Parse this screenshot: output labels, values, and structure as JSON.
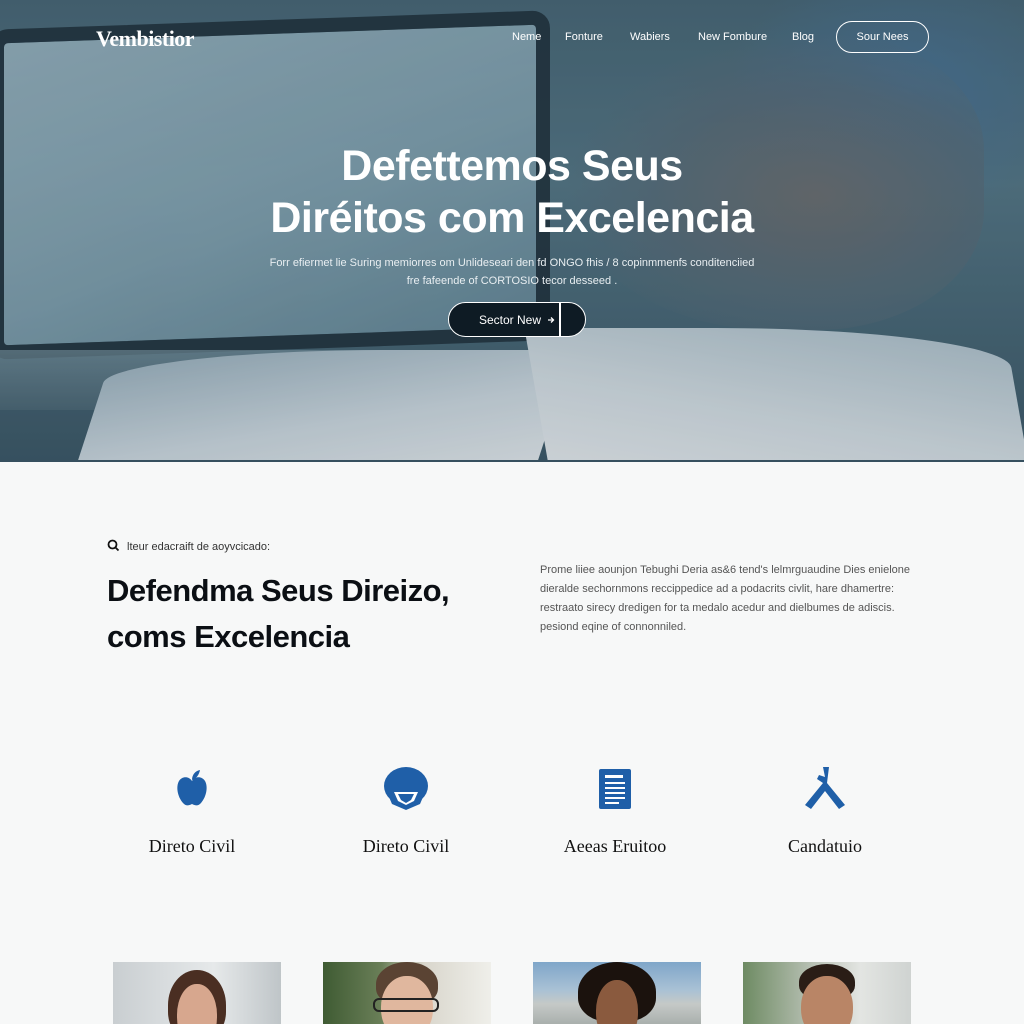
{
  "nav": {
    "logo": "Vembistior",
    "links": [
      "Neme",
      "Fonture",
      "Wabiers",
      "New Fombure",
      "Blog"
    ],
    "cta": "Sour Nees"
  },
  "hero": {
    "title_line1": "Defettemos Seus",
    "title_line2": "Diréitos com Excelencia",
    "sub_line1": "Forr efiermet lie Suring memiorres om Unlideseari den fd ONGO fhis / 8 copinmmenfs conditenciied",
    "sub_line2": "fre fafeende of CORTOSIO tecor desseed .",
    "button": "Sector New"
  },
  "intro": {
    "kicker": "lteur edacraift de aoyvcicado:",
    "title_line1": "Defendma Seus Direizo,",
    "title_line2": "coms Excelencia",
    "text": [
      "Prome liiee aounjon Tebughi Deria as&6 tend's lelmrguaudine Dies enielone",
      "dieralde sechornmons reccippedice ad a podacrits civlit, hare dhamertre:",
      "restraato sirecy dredigen for ta medalo acedur and dielbumes de adiscis.",
      "pesiond eqine of connonniled."
    ]
  },
  "services": [
    {
      "label": "Direto Civil",
      "icon": "apple-icon"
    },
    {
      "label": "Direto Civil",
      "icon": "shield-icon"
    },
    {
      "label": "Aeeas Eruitoo",
      "icon": "document-icon"
    },
    {
      "label": "Candatuio",
      "icon": "figure-icon"
    }
  ],
  "colors": {
    "accent": "#1f5fa8",
    "dark": "#0b0f14",
    "hero_overlay": "#3e5a68"
  }
}
